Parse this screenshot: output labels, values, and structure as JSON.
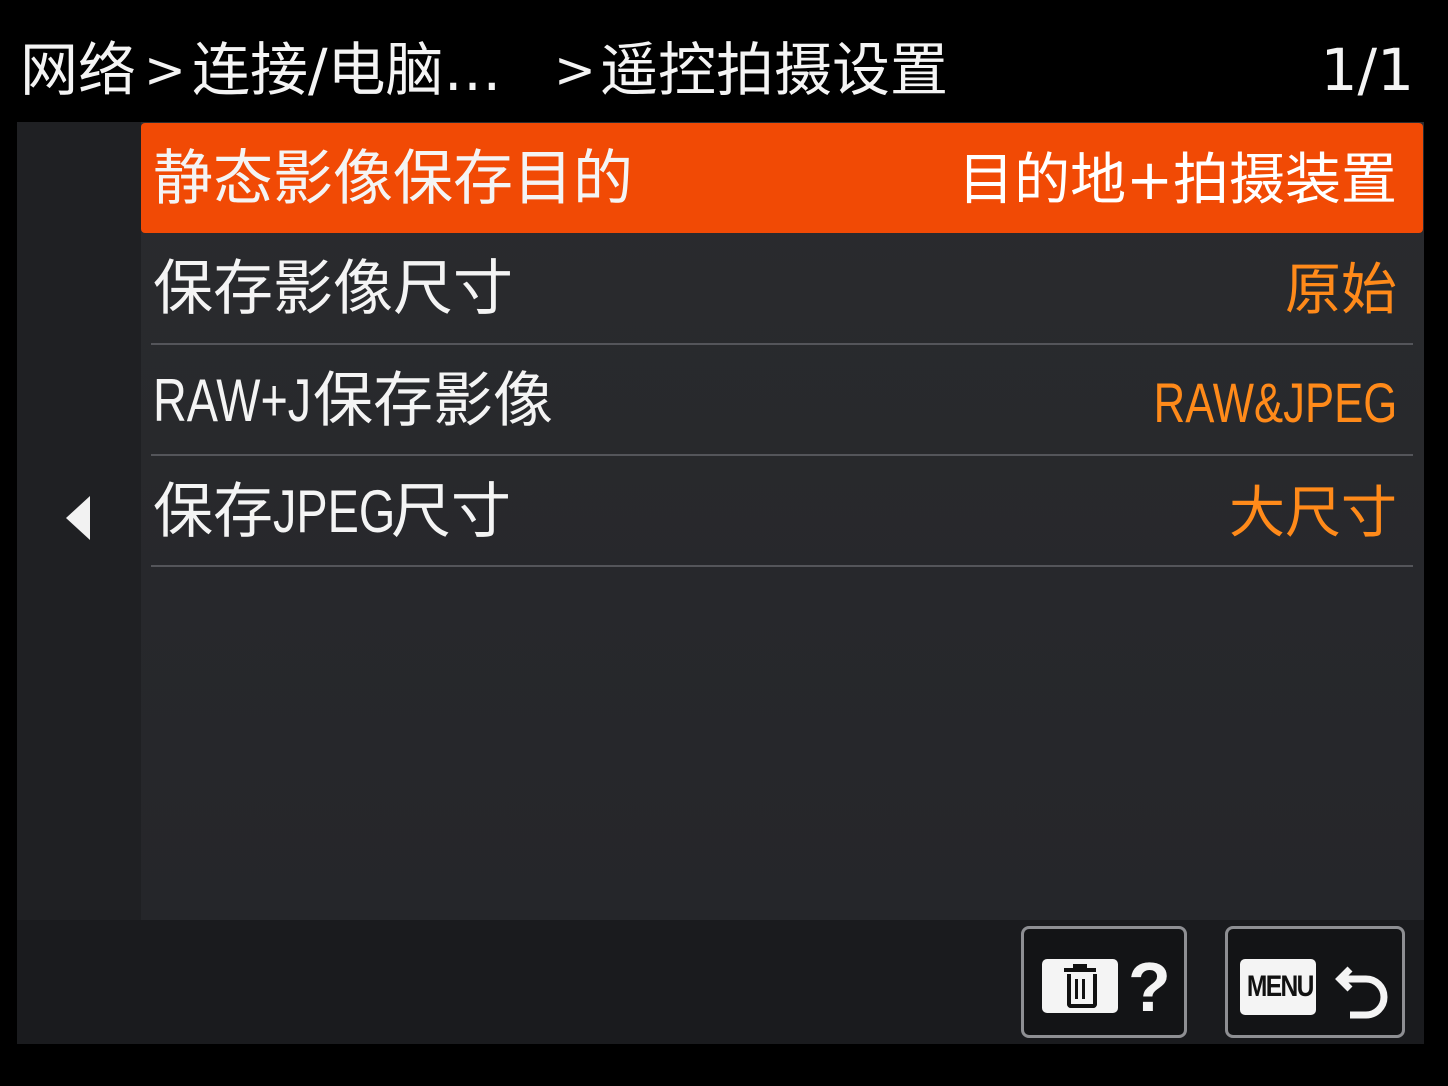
{
  "header": {
    "breadcrumb": [
      "网络",
      "连接/电脑…",
      "遥控拍摄设置"
    ],
    "separator": ">",
    "page_indicator": "1/1"
  },
  "menu": {
    "items": [
      {
        "label": "静态影像保存目的",
        "value": "目的地+拍摄装置",
        "selected": true
      },
      {
        "label": "保存影像尺寸",
        "value": "原始",
        "selected": false
      },
      {
        "label_latin": "RAW+J",
        "label": "保存影像",
        "value": "RAW&JPEG",
        "selected": false
      },
      {
        "label": "保存",
        "label_latin": "JPEG",
        "label_suffix": "尺寸",
        "value": "大尺寸",
        "selected": false
      }
    ]
  },
  "footer": {
    "delete_help": {
      "icon": "trash-icon",
      "help_glyph": "?"
    },
    "menu_return": {
      "menu_label": "MENU",
      "icon": "return-arrow-icon"
    }
  },
  "colors": {
    "selected_row": "#f14a05",
    "value_text": "#ff8a1a",
    "background": "#000000",
    "panel": "#2a2b2e"
  }
}
